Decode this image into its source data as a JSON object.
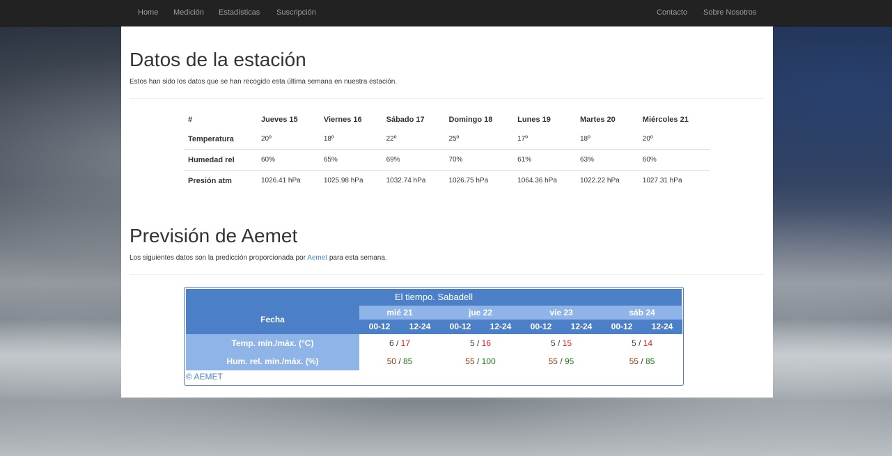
{
  "nav": {
    "left": [
      "Home",
      "Medición",
      "Estadísticas",
      "Suscripción"
    ],
    "right": [
      "Contacto",
      "Sobre Nosotros"
    ]
  },
  "station": {
    "title": "Datos de la estación",
    "intro": "Estos han sido los datos que se han recogido esta última semana en nuestra estación.",
    "table": {
      "corner": "#",
      "days": [
        "Jueves 15",
        "Viernes 16",
        "Sábado 17",
        "Domingo 18",
        "Lunes 19",
        "Martes 20",
        "Miércoles 21"
      ],
      "rows": [
        {
          "label": "Temperatura",
          "values": [
            "20º",
            "18º",
            "22º",
            "25º",
            "17º",
            "18º",
            "20º"
          ]
        },
        {
          "label": "Humedad rel",
          "values": [
            "60%",
            "65%",
            "69%",
            "70%",
            "61%",
            "63%",
            "60%"
          ]
        },
        {
          "label": "Presión atm",
          "values": [
            "1026.41 hPa",
            "1025.98 hPa",
            "1032.74 hPa",
            "1026.75 hPa",
            "1064.36 hPa",
            "1022.22 hPa",
            "1027.31 hPa"
          ]
        }
      ]
    }
  },
  "forecast": {
    "title": "Previsión de Aemet",
    "intro_before": "Los siguientes datos son la predicción proporcionada por ",
    "intro_link": "Aemet",
    "intro_after": " para esta semana.",
    "widget": {
      "title": "El tiempo. Sabadell",
      "fecha_label": "Fecha",
      "days": [
        "mié 21",
        "jue 22",
        "vie 23",
        "sáb 24"
      ],
      "periods": [
        "00-12",
        "12-24"
      ],
      "temp_label": "Temp. mín./máx. (°C)",
      "hum_label": "Hum. rel. mín./máx. (%)",
      "temps": [
        [
          "6",
          "17"
        ],
        [
          "5",
          "16"
        ],
        [
          "5",
          "15"
        ],
        [
          "5",
          "14"
        ]
      ],
      "hums": [
        [
          "50",
          "85"
        ],
        [
          "55",
          "100"
        ],
        [
          "55",
          "95"
        ],
        [
          "55",
          "85"
        ]
      ],
      "separator": " / ",
      "copyright": "© AEMET"
    }
  },
  "colors": {
    "navbar": "#222222",
    "widget_blue": "#4b80c8",
    "widget_light_blue": "#8fb4e8",
    "temp_max": "#e01b1b",
    "hum_max": "#1a7a1a",
    "hum_min": "#8b3a10",
    "link": "#428bca"
  }
}
